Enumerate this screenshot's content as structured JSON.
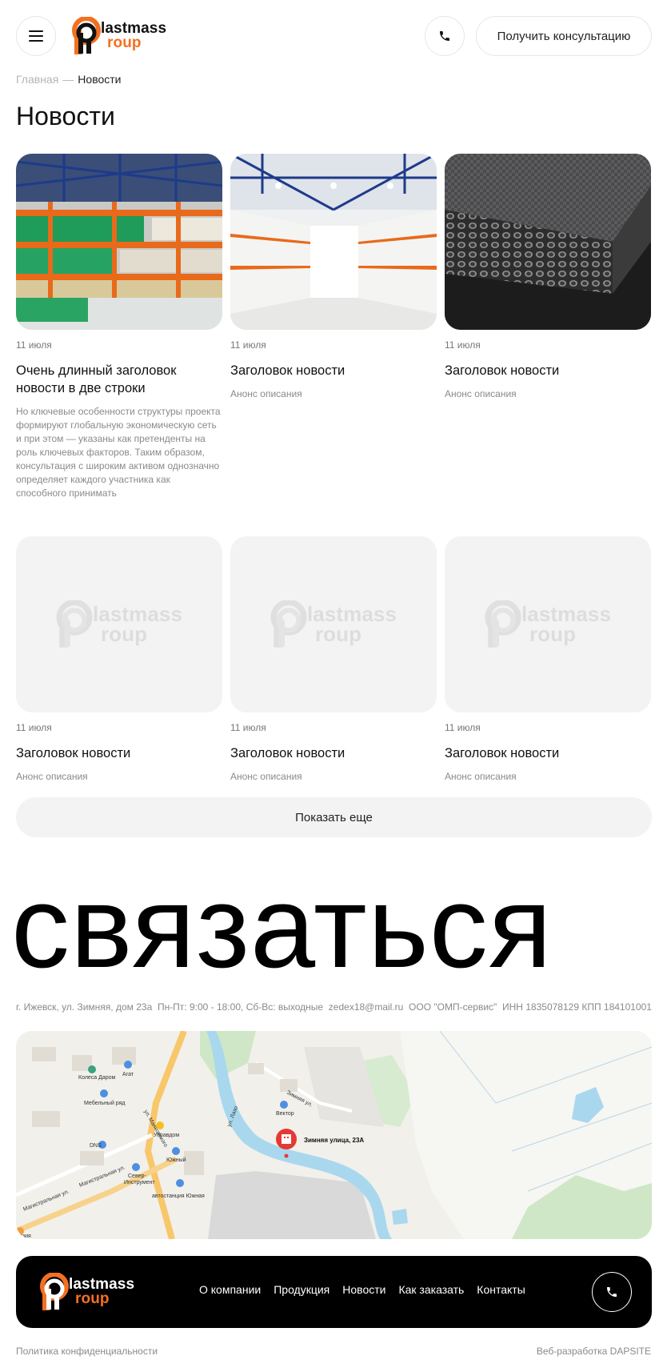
{
  "brand": {
    "logo_line1": "lastmass",
    "logo_line2": "roup",
    "accent_color": "#f37021"
  },
  "header": {
    "menu_icon": "hamburger-icon",
    "phone_icon": "phone-icon",
    "consult_label": "Получить консультацию"
  },
  "breadcrumb": {
    "home": "Главная",
    "separator": "—",
    "current": "Новости"
  },
  "page_title": "Новости",
  "news": [
    {
      "date": "11 июля",
      "title": "Очень длинный заголовок новости в две строки",
      "desc": "Но ключевые особенности структуры проекта формируют глобальную экономическую сеть и при этом — указаны как претенденты на роль ключевых факторов. Таким образом, консультация с широким активом однозначно определяет каждого участника как способного принимать"
    },
    {
      "date": "11 июля",
      "title": "Заголовок новости",
      "desc": "Анонс описания"
    },
    {
      "date": "11 июля",
      "title": "Заголовок новости",
      "desc": "Анонс описания"
    },
    {
      "date": "11 июля",
      "title": "Заголовок новости",
      "desc": "Анонс описания"
    },
    {
      "date": "11 июля",
      "title": "Заголовок новости",
      "desc": "Анонс описания"
    },
    {
      "date": "11 июля",
      "title": "Заголовок новости",
      "desc": "Анонс описания"
    }
  ],
  "placeholder_logo": {
    "line1": "lastmass",
    "line2": "roup"
  },
  "show_more": "Показать еще",
  "contact_title": "связаться",
  "contacts": {
    "address": "г. Ижевск, ул. Зимняя, дом 23а",
    "hours": "Пн-Пт: 9:00 - 18:00, Сб-Вс: выходные",
    "email": "zedex18@mail.ru",
    "company": "ООО \"ОМП-сервис\"",
    "inn": "ИНН 1835078129 КПП 184101001"
  },
  "map": {
    "pin_label": "Зимняя улица, 23А",
    "labels": {
      "koleso": "Колеса Даром",
      "agat": "Агат",
      "mebel": "Мебельный ряд",
      "upravdom": "Управдом",
      "dns": "DNS",
      "yuzhny": "Южный",
      "sever": "Север-",
      "instrument": "Инструмент",
      "avtostanciya": "автостанция Южная",
      "vektor": "Вектор",
      "street_zimnyaya": "Зимняя ул.",
      "street_magistral1": "Магистральная ул.",
      "street_magistral2": "Магистральная ул.",
      "street_mayakovskogo": "ул. Маяковского",
      "street_lazo": "ул. Лазо",
      "corner": "лазия"
    }
  },
  "footer": {
    "nav": [
      "О компании",
      "Продукция",
      "Новости",
      "Как заказать",
      "Контакты"
    ],
    "privacy": "Политика конфиденциальности",
    "dev": "Веб-разработка DAPSITE"
  }
}
